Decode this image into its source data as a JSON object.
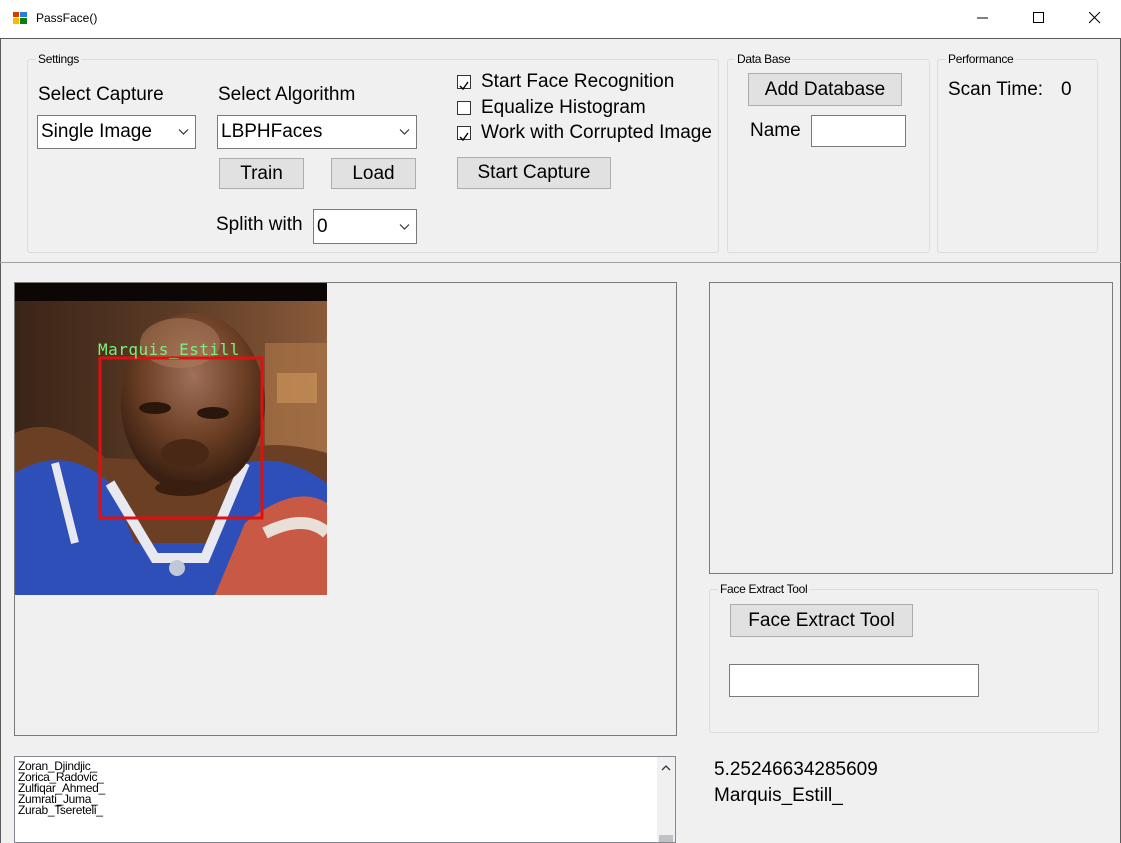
{
  "window": {
    "title": "PassFace()"
  },
  "settings": {
    "legend": "Settings",
    "capture_label": "Select Capture",
    "capture_value": "Single Image",
    "algorithm_label": "Select Algorithm",
    "algorithm_value": "LBPHFaces",
    "train_label": "Train",
    "load_label": "Load",
    "split_label": "Splith with",
    "split_value": "0",
    "checkboxes": [
      {
        "label": "Start Face Recognition",
        "checked": true
      },
      {
        "label": "Equalize Histogram",
        "checked": false
      },
      {
        "label": "Work with Corrupted Image",
        "checked": true
      }
    ],
    "start_capture_label": "Start Capture"
  },
  "database": {
    "legend": "Data Base",
    "add_label": "Add Database",
    "name_label": "Name",
    "name_value": ""
  },
  "performance": {
    "legend": "Performance",
    "scan_time_label": "Scan Time:",
    "scan_time_value": "0"
  },
  "image": {
    "overlay_name": "Marquis_Estill"
  },
  "face_extract": {
    "legend": "Face Extract Tool",
    "button_label": "Face Extract Tool",
    "input_value": ""
  },
  "names_list": [
    "Zoran_Djindjic_",
    "Zorica_Radovic_",
    "Zulfiqar_Ahmed_",
    "Zumrati_Juma_",
    "Zurab_Tsereteli_"
  ],
  "result": {
    "distance": "5.25246634285609",
    "name": "Marquis_Estill_"
  },
  "colors": {
    "detection_box": "#e01010",
    "name_text": "#7cf07c",
    "jersey": "#2f4fb8",
    "skin": "#6b3f24"
  }
}
